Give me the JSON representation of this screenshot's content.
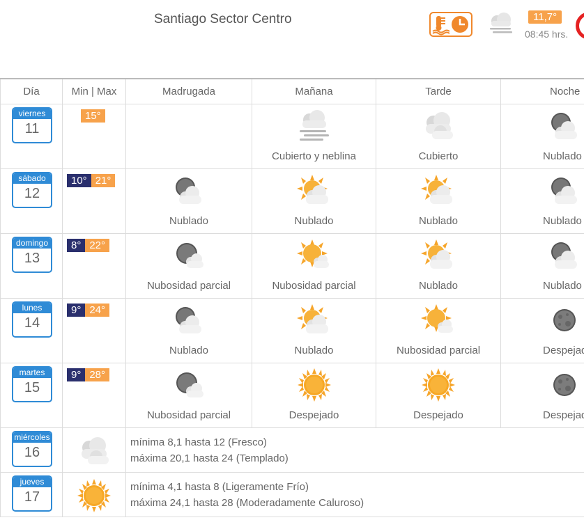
{
  "header": {
    "title": "Santiago Sector Centro",
    "current_temp": "11,7°",
    "current_time": "08:45 hrs.",
    "current_icon": "cloud-fog-icon"
  },
  "columns": [
    "Día",
    "Min | Max",
    "Madrugada",
    "Mañana",
    "Tarde",
    "Noche"
  ],
  "days": [
    {
      "weekday": "viernes",
      "day": "11",
      "min": "",
      "max": "15°",
      "periods": [
        {
          "icon": "",
          "label": ""
        },
        {
          "icon": "cloud-fog-icon",
          "label": "Cubierto y neblina"
        },
        {
          "icon": "cloud-icon",
          "label": "Cubierto"
        },
        {
          "icon": "moon-cloud-icon",
          "label": "Nublado"
        }
      ]
    },
    {
      "weekday": "sábado",
      "day": "12",
      "min": "10°",
      "max": "21°",
      "periods": [
        {
          "icon": "moon-cloud-icon",
          "label": "Nublado"
        },
        {
          "icon": "sun-cloud-icon",
          "label": "Nublado"
        },
        {
          "icon": "sun-cloud-icon",
          "label": "Nublado"
        },
        {
          "icon": "moon-cloud-icon",
          "label": "Nublado"
        }
      ]
    },
    {
      "weekday": "domingo",
      "day": "13",
      "min": "8°",
      "max": "22°",
      "periods": [
        {
          "icon": "moon-partly-cloudy-icon",
          "label": "Nubosidad parcial"
        },
        {
          "icon": "sun-partly-cloudy-icon",
          "label": "Nubosidad parcial"
        },
        {
          "icon": "sun-cloud-icon",
          "label": "Nublado"
        },
        {
          "icon": "moon-cloud-icon",
          "label": "Nublado"
        }
      ]
    },
    {
      "weekday": "lunes",
      "day": "14",
      "min": "9°",
      "max": "24°",
      "periods": [
        {
          "icon": "moon-cloud-icon",
          "label": "Nublado"
        },
        {
          "icon": "sun-cloud-icon",
          "label": "Nublado"
        },
        {
          "icon": "sun-partly-cloudy-icon",
          "label": "Nubosidad parcial"
        },
        {
          "icon": "moon-icon",
          "label": "Despejado"
        }
      ]
    },
    {
      "weekday": "martes",
      "day": "15",
      "min": "9°",
      "max": "28°",
      "periods": [
        {
          "icon": "moon-partly-cloudy-icon",
          "label": "Nubosidad parcial"
        },
        {
          "icon": "sun-icon",
          "label": "Despejado"
        },
        {
          "icon": "sun-icon",
          "label": "Despejado"
        },
        {
          "icon": "moon-icon",
          "label": "Despejado"
        }
      ]
    }
  ],
  "extended": [
    {
      "weekday": "miércoles",
      "day": "16",
      "icon": "cloud-icon",
      "line1": "mínima 8,1 hasta 12 (Fresco)",
      "line2": "máxima 20,1 hasta 24 (Templado)"
    },
    {
      "weekday": "jueves",
      "day": "17",
      "icon": "sun-icon",
      "line1": "mínima 4,1 hasta 8 (Ligeramente Frío)",
      "line2": "máxima 24,1 hasta 28 (Moderadamente Caluroso)"
    }
  ],
  "colors": {
    "calendar_blue": "#2f8bd6",
    "min_badge": "#2a2f6d",
    "max_badge": "#f7a24b",
    "accent_orange": "#f0882c",
    "alert_red": "#e52222"
  }
}
